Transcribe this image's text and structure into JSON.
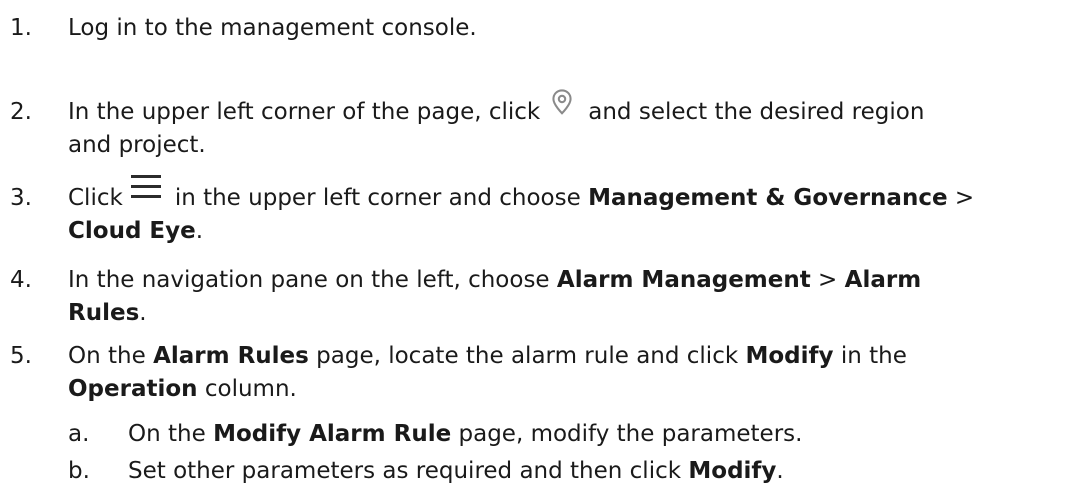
{
  "steps": [
    {
      "num": "1.",
      "text": "Log in to the management console."
    },
    {
      "num": "2.",
      "pre": "In the upper left corner of the page, click",
      "post_line1": "and select the desired region",
      "line2": "and project.",
      "icon": "location-pin-icon"
    },
    {
      "num": "3.",
      "pre": "Click",
      "mid": "in the upper left corner and choose",
      "b1": "Management & Governance",
      "sep": " >",
      "b2": "Cloud Eye",
      "end": ".",
      "icon": "hamburger-menu-icon"
    },
    {
      "num": "4.",
      "pre": "In the navigation pane on the left, choose",
      "b1": "Alarm Management",
      "sep": " > ",
      "b2a": "Alarm",
      "b2b": "Rules",
      "end": "."
    },
    {
      "num": "5.",
      "pre": "On the",
      "b1": "Alarm Rules",
      "mid": "page, locate the alarm rule and click",
      "b2": "Modify",
      "mid2": "in the",
      "b3": "Operation",
      "end": "column."
    }
  ],
  "substeps": [
    {
      "num": "a.",
      "pre": "On the",
      "b1": "Modify Alarm Rule",
      "end": "page, modify the parameters."
    },
    {
      "num": "b.",
      "pre": "Set other parameters as required and then click",
      "b1": "Modify",
      "end": "."
    }
  ],
  "colors": {
    "icon": "#8a8a8a",
    "menu": "#2b2b2b",
    "text": "#1a1a1a"
  }
}
